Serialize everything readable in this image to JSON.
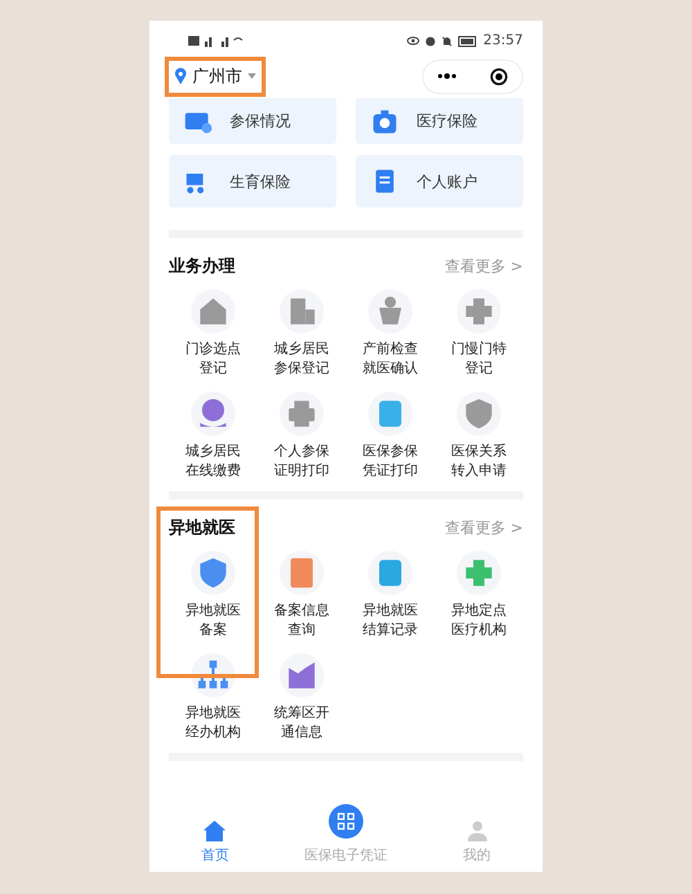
{
  "status_bar": {
    "time": "23:57"
  },
  "header": {
    "city": "广州市",
    "city_highlighted": true
  },
  "quick_cards": [
    {
      "label": "参保情况",
      "kind": "card"
    },
    {
      "label": "医疗保险",
      "kind": "kit"
    },
    {
      "label": "生育保险",
      "kind": "stroller"
    },
    {
      "label": "个人账户",
      "kind": "doc"
    }
  ],
  "sections": [
    {
      "title": "业务办理",
      "more": "查看更多 >",
      "items": [
        {
          "lines": [
            "门诊选点",
            "登记"
          ],
          "kind": "house",
          "color": "#9a9a9a"
        },
        {
          "lines": [
            "城乡居民",
            "参保登记"
          ],
          "kind": "building",
          "color": "#9a9a9a"
        },
        {
          "lines": [
            "产前检查",
            "就医确认"
          ],
          "kind": "person",
          "color": "#9a9a9a"
        },
        {
          "lines": [
            "门慢门特",
            "登记"
          ],
          "kind": "cross",
          "color": "#9a9a9a"
        },
        {
          "lines": [
            "城乡居民",
            "在线缴费"
          ],
          "kind": "coin",
          "color": "#8e6fd8"
        },
        {
          "lines": [
            "个人参保",
            "证明打印"
          ],
          "kind": "printer",
          "color": "#9a9a9a"
        },
        {
          "lines": [
            "医保参保",
            "凭证打印"
          ],
          "kind": "receipt",
          "color": "#3ab0e8"
        },
        {
          "lines": [
            "医保关系",
            "转入申请"
          ],
          "kind": "shield",
          "color": "#9a9a9a"
        }
      ]
    },
    {
      "title": "异地就医",
      "more": "查看更多 >",
      "annotation_box": true,
      "items": [
        {
          "lines": [
            "异地就医",
            "备案"
          ],
          "kind": "shield",
          "color": "#4a8ff0"
        },
        {
          "lines": [
            "备案信息",
            "查询"
          ],
          "kind": "doc",
          "color": "#f08a5a"
        },
        {
          "lines": [
            "异地就医",
            "结算记录"
          ],
          "kind": "receipt",
          "color": "#2aa8e0"
        },
        {
          "lines": [
            "异地定点",
            "医疗机构"
          ],
          "kind": "cross",
          "color": "#3cc070"
        },
        {
          "lines": [
            "异地就医",
            "经办机构"
          ],
          "kind": "tree",
          "color": "#4a8ff0"
        },
        {
          "lines": [
            "统筹区开",
            "通信息"
          ],
          "kind": "chart",
          "color": "#8e6fd8"
        }
      ]
    }
  ],
  "tab_bar": [
    {
      "label": "首页",
      "kind": "home",
      "selected": true
    },
    {
      "label": "医保电子凭证",
      "kind": "qr",
      "selected": false
    },
    {
      "label": "我的",
      "kind": "user",
      "selected": false
    }
  ]
}
